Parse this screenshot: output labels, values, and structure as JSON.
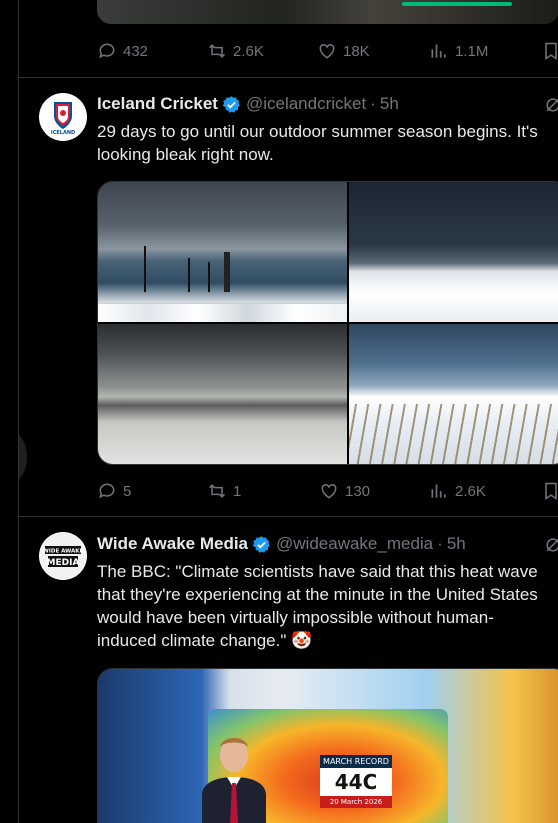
{
  "top_tweet": {
    "actions": {
      "replies": "432",
      "reposts": "2.6K",
      "likes": "18K",
      "views": "1.1M"
    }
  },
  "tweets": [
    {
      "name": "Iceland Cricket",
      "handle": "@icelandcricket",
      "separator": "·",
      "time": "5h",
      "avatar_text": "ICELAND",
      "text_lines": [
        "29 days to go until our outdoor summer season begins. It's",
        "looking bleak right now."
      ],
      "actions": {
        "replies": "5",
        "reposts": "1",
        "likes": "130",
        "views": "2.6K"
      }
    },
    {
      "name": "Wide Awake Media",
      "handle": "@wideawake_media",
      "separator": "·",
      "time": "5h",
      "avatar_text": [
        "WIDE AWAKE",
        "MEDIA"
      ],
      "text_lines": [
        "The BBC: \"Climate scientists have said that this heat wave",
        "that they're experiencing at the minute in the United States",
        "would have been virtually impossible without human-",
        "induced climate change.\" 🤡"
      ],
      "video_overlay": {
        "title": "MARCH RECORD",
        "value": "44C",
        "date": "20 March 2026"
      }
    }
  ],
  "colors": {
    "background": "#000000",
    "text": "#e7e9ea",
    "muted": "#71767b",
    "verified": "#1d9bf0",
    "divider": "#2f3336",
    "progress": "#00ba7c"
  }
}
